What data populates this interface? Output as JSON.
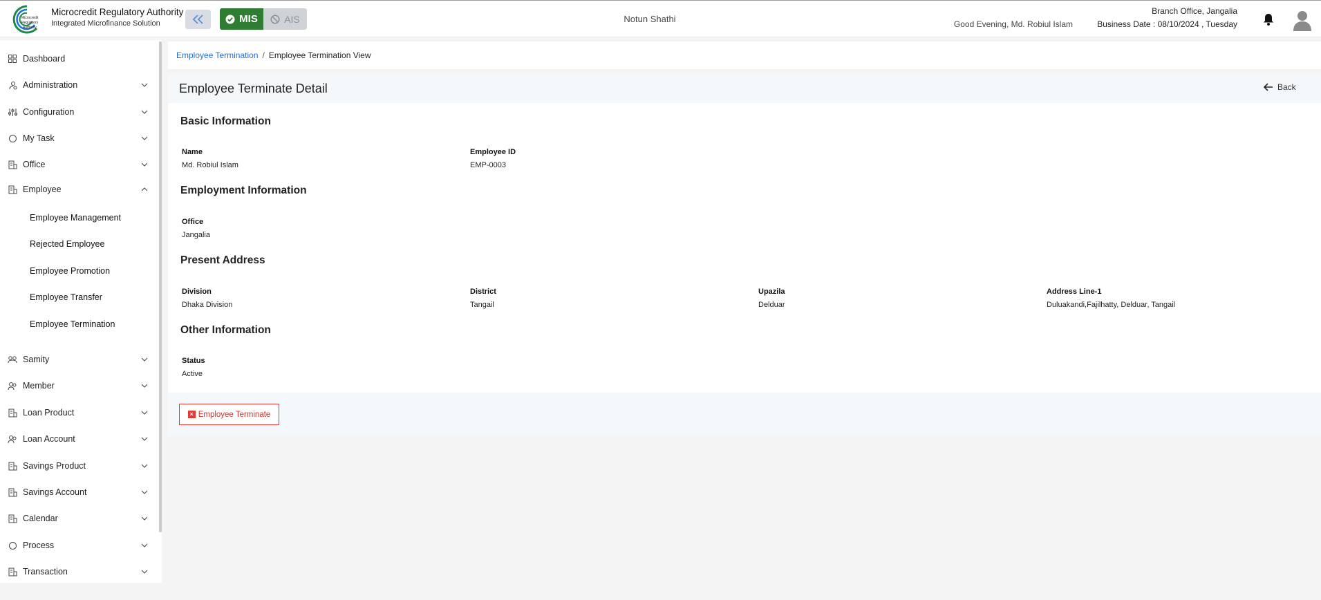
{
  "header": {
    "brand_title": "Microcredit Regulatory Authority",
    "brand_subtitle": "Integrated Microfinance Solution",
    "mode_mis": "MIS",
    "mode_ais": "AIS",
    "center_title": "Notun Shathi",
    "greeting": "Good Evening, Md. Robiul Islam",
    "branch": "Branch Office, Jangalia",
    "business_date": "Business Date : 08/10/2024 , Tuesday",
    "accent_color": "#2e7d32"
  },
  "sidebar": {
    "items": [
      {
        "label": "Dashboard",
        "icon": "grid-icon"
      },
      {
        "label": "Administration",
        "icon": "admin-icon"
      },
      {
        "label": "Configuration",
        "icon": "sliders-icon"
      },
      {
        "label": "My Task",
        "icon": "circle-icon"
      },
      {
        "label": "Office",
        "icon": "building-icon"
      },
      {
        "label": "Employee",
        "icon": "building-icon"
      },
      {
        "label": "Samity",
        "icon": "group-icon"
      },
      {
        "label": "Member",
        "icon": "users-icon"
      },
      {
        "label": "Loan Product",
        "icon": "building-icon"
      },
      {
        "label": "Loan Account",
        "icon": "users-icon"
      },
      {
        "label": "Savings Product",
        "icon": "building-icon"
      },
      {
        "label": "Savings Account",
        "icon": "building-icon"
      },
      {
        "label": "Calendar",
        "icon": "building-icon"
      },
      {
        "label": "Process",
        "icon": "circle-icon"
      },
      {
        "label": "Transaction",
        "icon": "building-icon"
      }
    ],
    "employee_sub": [
      "Employee Management",
      "Rejected Employee",
      "Employee Promotion",
      "Employee Transfer",
      "Employee Termination"
    ]
  },
  "breadcrumb": {
    "parent": "Employee Termination",
    "separator": "/",
    "current": "Employee Termination View"
  },
  "detail": {
    "title": "Employee Terminate Detail",
    "back_label": "Back",
    "basic": {
      "title": "Basic Information",
      "name_label": "Name",
      "name_value": "Md. Robiul Islam",
      "id_label": "Employee ID",
      "id_value": "EMP-0003"
    },
    "employment": {
      "title": "Employment Information",
      "office_label": "Office",
      "office_value": "Jangalia"
    },
    "address": {
      "title": "Present Address",
      "division_label": "Division",
      "division_value": "Dhaka Division",
      "district_label": "District",
      "district_value": "Tangail",
      "upazila_label": "Upazila",
      "upazila_value": "Delduar",
      "line1_label": "Address Line-1",
      "line1_value": "Duluakandi,Fajilhatty, Delduar, Tangail"
    },
    "other": {
      "title": "Other Information",
      "status_label": "Status",
      "status_value": "Active"
    },
    "terminate_label": "Employee Terminate"
  }
}
